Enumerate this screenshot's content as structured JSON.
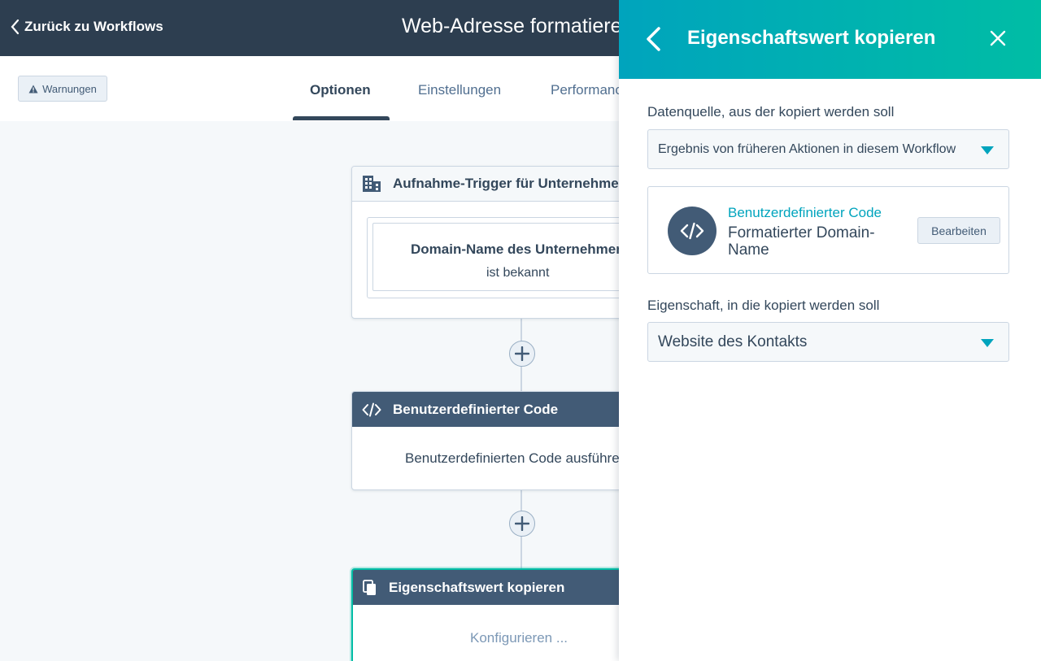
{
  "header": {
    "back_label": "Zurück zu Workflows",
    "workflow_title": "Web-Adresse formatieren"
  },
  "toolbar": {
    "warnings_label": "Warnungen"
  },
  "tabs": [
    {
      "label": "Optionen",
      "active": true
    },
    {
      "label": "Einstellungen",
      "active": false
    },
    {
      "label": "Performance",
      "active": false
    }
  ],
  "canvas": {
    "trigger": {
      "title": "Aufnahme-Trigger für Unternehmen",
      "icon": "building-icon",
      "condition_property": "Domain-Name des Unternehmens",
      "condition_operator": "ist bekannt"
    },
    "action_code": {
      "title": "Benutzerdefinierter Code",
      "icon": "code-icon",
      "body": "Benutzerdefinierten Code ausführen"
    },
    "action_copy": {
      "title": "Eigenschaftswert kopieren",
      "icon": "copy-icon",
      "body": "Konfigurieren ..."
    }
  },
  "panel": {
    "title": "Eigenschaftswert kopieren",
    "source_label": "Datenquelle, aus der kopiert werden soll",
    "source_value": "Ergebnis von früheren Aktionen in diesem Workflow",
    "source_card": {
      "action_name": "Benutzerdefinierter Code",
      "output_name": "Formatierter Domain-Name",
      "edit_label": "Bearbeiten"
    },
    "target_label": "Eigenschaft, in die kopiert werden soll",
    "target_value": "Website des Kontakts"
  },
  "colors": {
    "header_bg": "#2d3e50",
    "panel_gradient_start": "#00a4bd",
    "panel_gradient_end": "#00bda5",
    "accent_link": "#00a4bd",
    "card_head_dark": "#425b76"
  }
}
